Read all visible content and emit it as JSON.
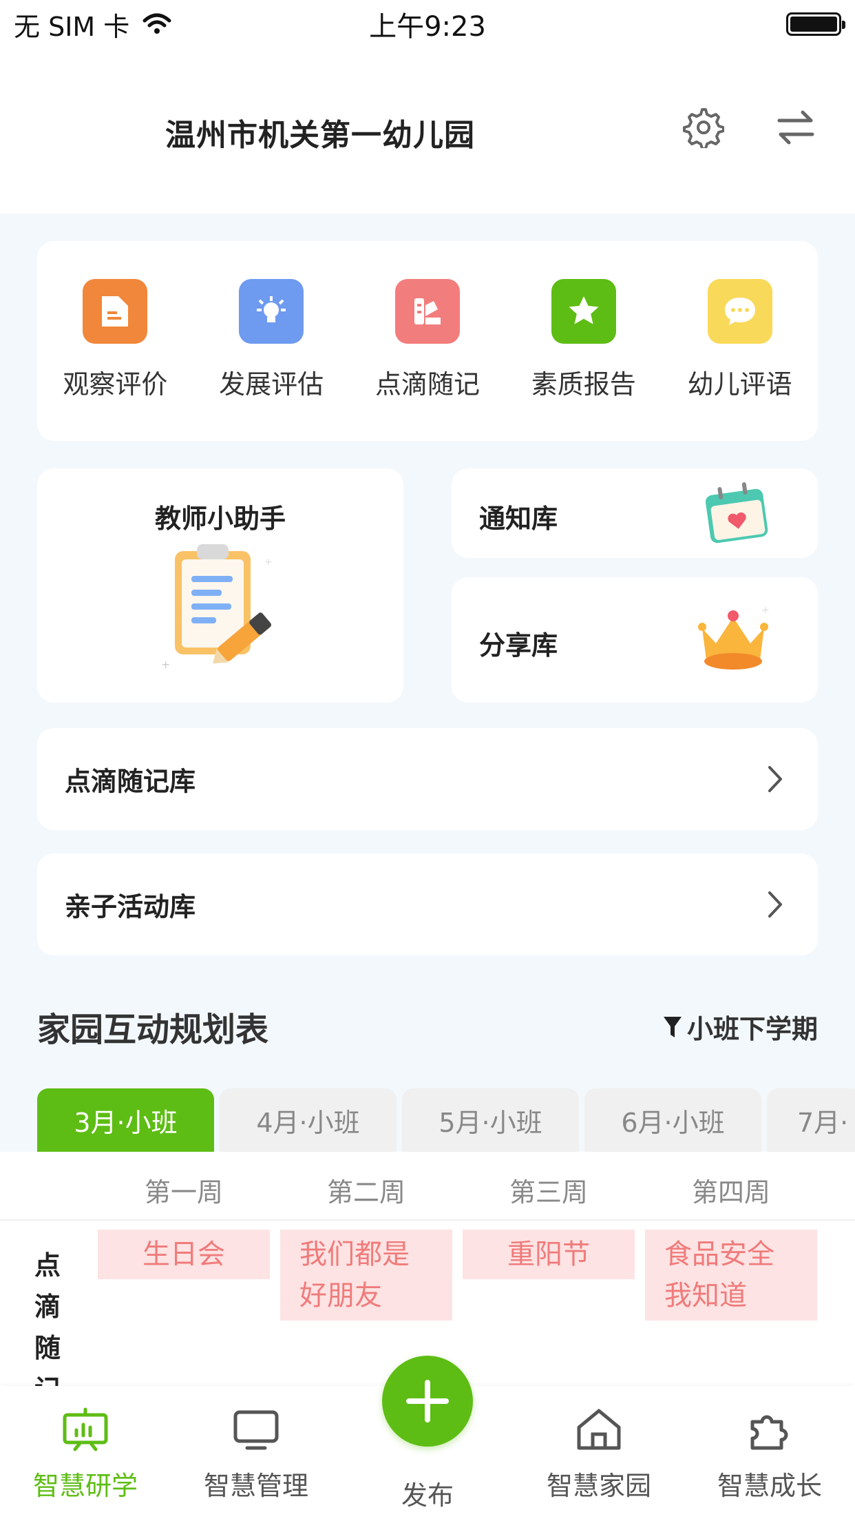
{
  "status_bar": {
    "carrier": "无 SIM 卡",
    "time": "上午9:23"
  },
  "header": {
    "title": "温州市机关第一幼儿园"
  },
  "quick_actions": [
    {
      "label": "观察评价",
      "icon": "document-icon",
      "color": "#f0873a"
    },
    {
      "label": "发展评估",
      "icon": "lightbulb-icon",
      "color": "#6e9af0"
    },
    {
      "label": "点滴随记",
      "icon": "palette-icon",
      "color": "#f27d7d"
    },
    {
      "label": "素质报告",
      "icon": "star-icon",
      "color": "#5ebd14"
    },
    {
      "label": "幼儿评语",
      "icon": "chat-icon",
      "color": "#f9d95a"
    }
  ],
  "assistant": {
    "title": "教师小助手"
  },
  "libraries": {
    "notice": "通知库",
    "share": "分享库"
  },
  "rows": {
    "notes_library": "点滴随记库",
    "activity_library": "亲子活动库"
  },
  "planner": {
    "title": "家园互动规划表",
    "filter": "小班下学期",
    "tabs": [
      "3月·小班",
      "4月·小班",
      "5月·小班",
      "6月·小班",
      "7月·"
    ],
    "weeks": [
      "第一周",
      "第二周",
      "第三周",
      "第四周"
    ],
    "row_label": "点滴随记",
    "events": [
      "生日会",
      "我们都是好朋友",
      "重阳节",
      "食品安全我知道"
    ]
  },
  "tabbar": {
    "items": [
      "智慧研学",
      "智慧管理",
      "发布",
      "智慧家园",
      "智慧成长"
    ],
    "accent": "#5ebd14"
  }
}
